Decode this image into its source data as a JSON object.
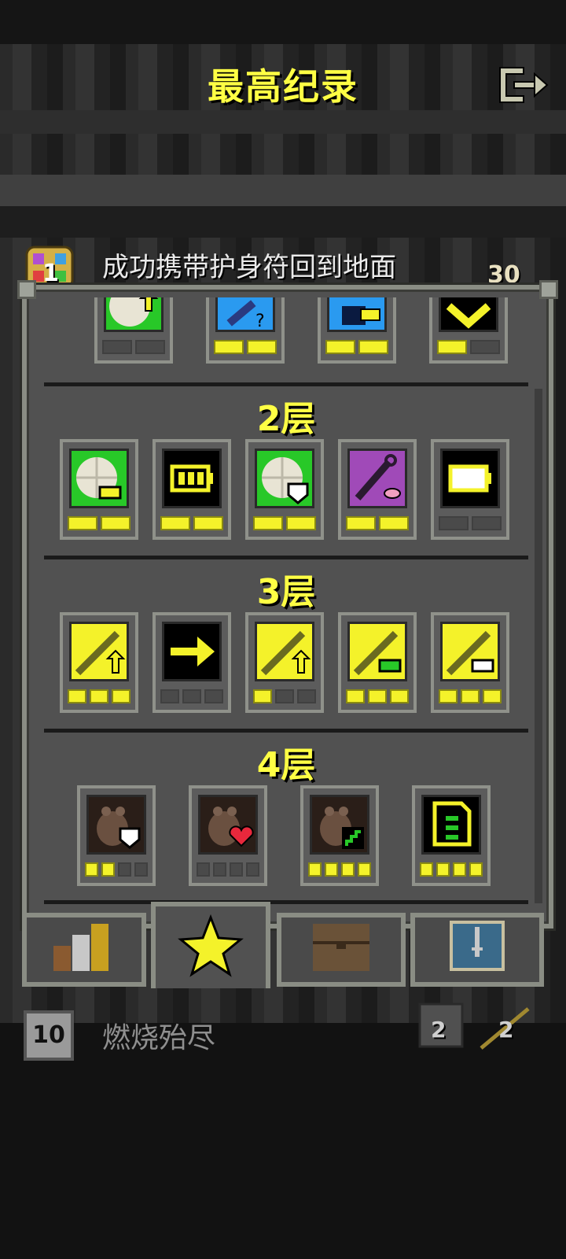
{
  "header": {
    "title": "最高纪录",
    "record_text": "成功携带护身符回到地面",
    "rank": "1",
    "depth": "30"
  },
  "floors": [
    {
      "label": "2层"
    },
    {
      "label": "3层"
    },
    {
      "label": "4层"
    }
  ],
  "top_row_partial": [
    {
      "icon": "wheel-up-icon",
      "pips": [
        0,
        0
      ]
    },
    {
      "icon": "wand-question-icon",
      "pips": [
        1,
        1
      ]
    },
    {
      "icon": "chest-key-icon",
      "pips": [
        1,
        1
      ]
    },
    {
      "icon": "chevron-down-icon",
      "pips": [
        1,
        0
      ]
    }
  ],
  "floor2_badges": [
    {
      "icon": "wheel-battery-icon",
      "pips": [
        1,
        1
      ]
    },
    {
      "icon": "battery-full-icon",
      "pips": [
        1,
        1
      ]
    },
    {
      "icon": "wheel-shield-icon",
      "pips": [
        1,
        1
      ]
    },
    {
      "icon": "staff-pink-icon",
      "pips": [
        1,
        1
      ]
    },
    {
      "icon": "battery-empty-icon",
      "pips": [
        0,
        0
      ]
    }
  ],
  "floor3_badges": [
    {
      "icon": "sword-up-icon",
      "pips": [
        1,
        1,
        1
      ]
    },
    {
      "icon": "arrow-right-icon",
      "pips": [
        0,
        0,
        0
      ]
    },
    {
      "icon": "sword-up-icon",
      "pips": [
        1,
        0,
        0
      ]
    },
    {
      "icon": "sword-green-battery-icon",
      "pips": [
        1,
        1,
        1
      ]
    },
    {
      "icon": "sword-white-battery-icon",
      "pips": [
        1,
        1,
        1
      ]
    }
  ],
  "floor4_badges": [
    {
      "icon": "rat-shield-icon",
      "pips": [
        1,
        1,
        0,
        0
      ]
    },
    {
      "icon": "rat-heart-icon",
      "pips": [
        0,
        0,
        0,
        0
      ]
    },
    {
      "icon": "rat-stairs-icon",
      "pips": [
        1,
        1,
        1,
        1
      ]
    },
    {
      "icon": "scroll-map-icon",
      "pips": [
        1,
        1,
        1,
        1
      ]
    }
  ],
  "tabs": [
    {
      "name": "stats-tab"
    },
    {
      "name": "badges-tab"
    },
    {
      "name": "items-tab"
    },
    {
      "name": "journal-tab"
    }
  ],
  "footer": {
    "level": "10",
    "cause": "燃烧殆尽",
    "stat_a": "2",
    "stat_b": "2"
  },
  "colors": {
    "accent_yellow": "#ffff44",
    "pip_on": "#f4f22a",
    "panel": "#515151"
  }
}
